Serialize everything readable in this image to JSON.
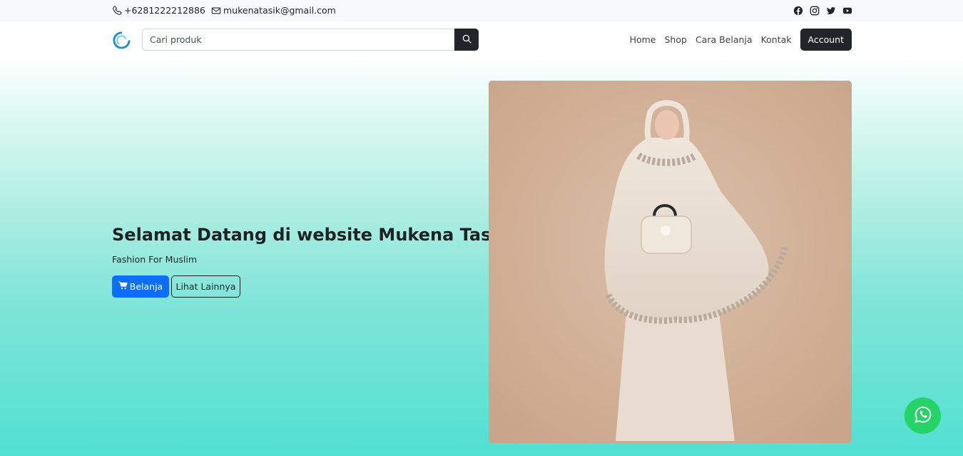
{
  "topbar": {
    "phone": "+6281222212886",
    "email": "mukenatasik@gmail.com",
    "phone_icon": "phone-icon",
    "email_icon": "envelope-icon",
    "social": [
      "facebook-icon",
      "instagram-icon",
      "twitter-icon",
      "youtube-icon"
    ]
  },
  "navbar": {
    "logo_icon": "store-logo-icon",
    "search": {
      "placeholder": "Cari produk",
      "value": ""
    },
    "search_icon": "search-icon",
    "menu": [
      "Home",
      "Shop",
      "Cara Belanja",
      "Kontak"
    ],
    "account_label": "Account"
  },
  "hero": {
    "title": "Selamat Datang di website Mukena Tasik",
    "tagline": "Fashion For Muslim",
    "shop_label": "Belanja",
    "shop_icon": "cart-icon",
    "more_label": "Lihat Lainnya",
    "image_alt": "product photo of woman wearing cream mukena holding a handbag"
  },
  "whatsapp_icon": "whatsapp-icon",
  "colors": {
    "primary": "#0d6efd",
    "dark": "#212529",
    "whatsapp": "#25d366",
    "hero_gradient_end": "#50e0d1"
  }
}
